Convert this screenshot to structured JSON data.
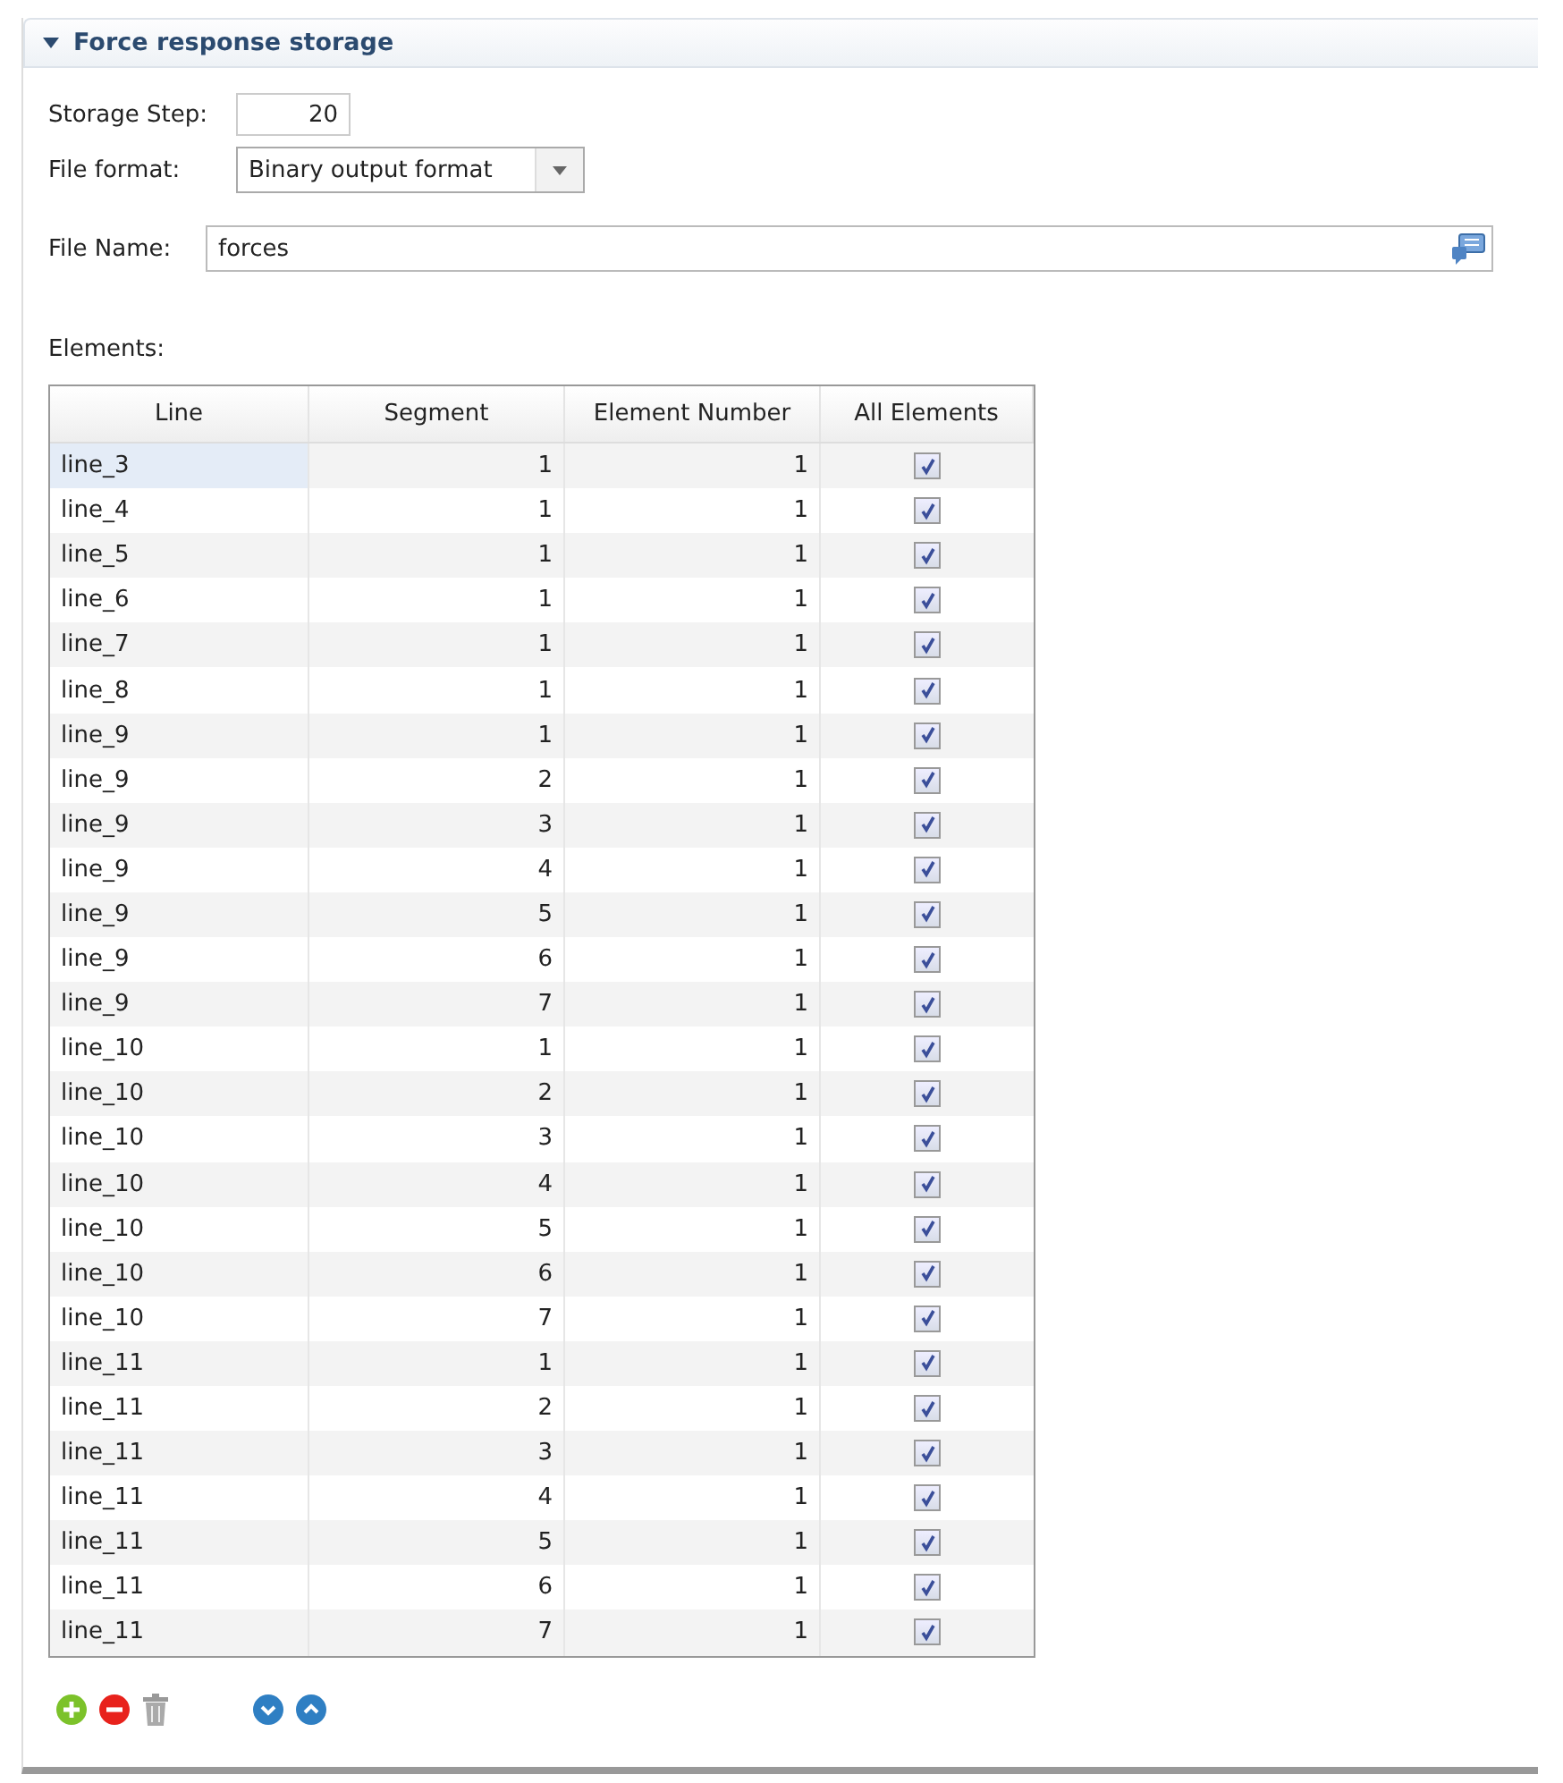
{
  "section": {
    "title": "Force response storage",
    "expanded": true
  },
  "storage_step": {
    "label": "Storage Step:",
    "value": "20"
  },
  "file_format": {
    "label": "File format:",
    "value": "Binary output format"
  },
  "file_name": {
    "label": "File Name:",
    "value": "forces"
  },
  "elements": {
    "label": "Elements:",
    "columns": [
      "Line",
      "Segment",
      "Element Number",
      "All Elements"
    ],
    "rows": [
      {
        "line": "line_3",
        "segment": "1",
        "element": "1",
        "all": true,
        "selected": true
      },
      {
        "line": "line_4",
        "segment": "1",
        "element": "1",
        "all": true,
        "selected": false
      },
      {
        "line": "line_5",
        "segment": "1",
        "element": "1",
        "all": true,
        "selected": false
      },
      {
        "line": "line_6",
        "segment": "1",
        "element": "1",
        "all": true,
        "selected": false
      },
      {
        "line": "line_7",
        "segment": "1",
        "element": "1",
        "all": true,
        "selected": false
      },
      {
        "line": "line_8",
        "segment": "1",
        "element": "1",
        "all": true,
        "selected": false
      },
      {
        "line": "line_9",
        "segment": "1",
        "element": "1",
        "all": true,
        "selected": false
      },
      {
        "line": "line_9",
        "segment": "2",
        "element": "1",
        "all": true,
        "selected": false
      },
      {
        "line": "line_9",
        "segment": "3",
        "element": "1",
        "all": true,
        "selected": false
      },
      {
        "line": "line_9",
        "segment": "4",
        "element": "1",
        "all": true,
        "selected": false
      },
      {
        "line": "line_9",
        "segment": "5",
        "element": "1",
        "all": true,
        "selected": false
      },
      {
        "line": "line_9",
        "segment": "6",
        "element": "1",
        "all": true,
        "selected": false
      },
      {
        "line": "line_9",
        "segment": "7",
        "element": "1",
        "all": true,
        "selected": false
      },
      {
        "line": "line_10",
        "segment": "1",
        "element": "1",
        "all": true,
        "selected": false
      },
      {
        "line": "line_10",
        "segment": "2",
        "element": "1",
        "all": true,
        "selected": false
      },
      {
        "line": "line_10",
        "segment": "3",
        "element": "1",
        "all": true,
        "selected": false
      },
      {
        "line": "line_10",
        "segment": "4",
        "element": "1",
        "all": true,
        "selected": false
      },
      {
        "line": "line_10",
        "segment": "5",
        "element": "1",
        "all": true,
        "selected": false
      },
      {
        "line": "line_10",
        "segment": "6",
        "element": "1",
        "all": true,
        "selected": false
      },
      {
        "line": "line_10",
        "segment": "7",
        "element": "1",
        "all": true,
        "selected": false
      },
      {
        "line": "line_11",
        "segment": "1",
        "element": "1",
        "all": true,
        "selected": false
      },
      {
        "line": "line_11",
        "segment": "2",
        "element": "1",
        "all": true,
        "selected": false
      },
      {
        "line": "line_11",
        "segment": "3",
        "element": "1",
        "all": true,
        "selected": false
      },
      {
        "line": "line_11",
        "segment": "4",
        "element": "1",
        "all": true,
        "selected": false
      },
      {
        "line": "line_11",
        "segment": "5",
        "element": "1",
        "all": true,
        "selected": false
      },
      {
        "line": "line_11",
        "segment": "6",
        "element": "1",
        "all": true,
        "selected": false
      },
      {
        "line": "line_11",
        "segment": "7",
        "element": "1",
        "all": true,
        "selected": false
      }
    ]
  }
}
